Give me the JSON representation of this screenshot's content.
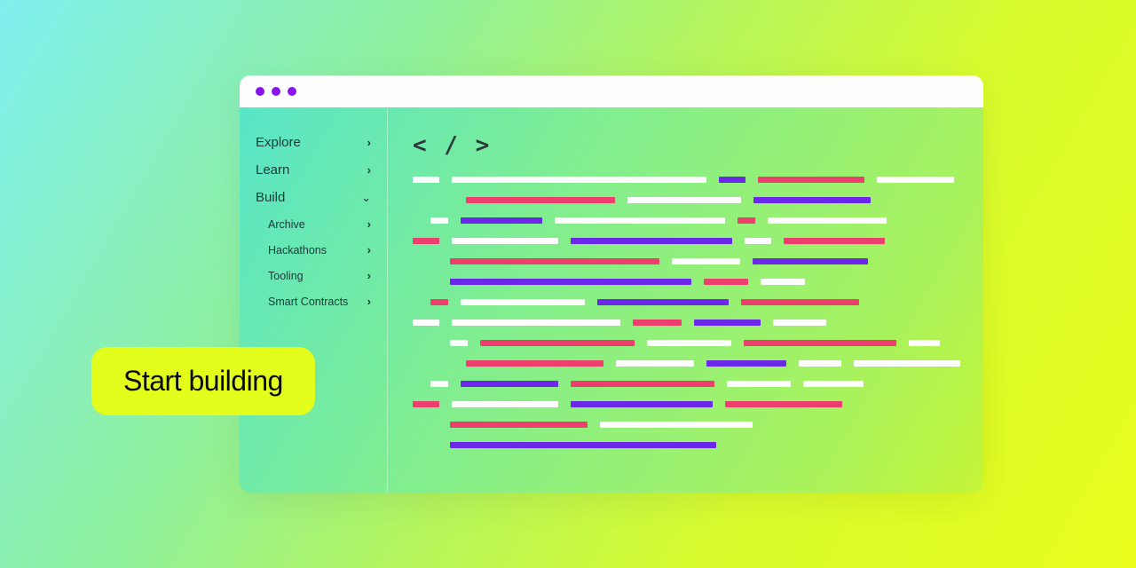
{
  "sidebar": {
    "items": [
      {
        "label": "Explore",
        "expanded": false
      },
      {
        "label": "Learn",
        "expanded": false
      },
      {
        "label": "Build",
        "expanded": true,
        "children": [
          {
            "label": "Archive"
          },
          {
            "label": "Hackathons"
          },
          {
            "label": "Tooling"
          },
          {
            "label": "Smart Contracts"
          }
        ]
      }
    ]
  },
  "code_icon": "< / >",
  "cta": {
    "label": "Start building"
  },
  "colors": {
    "accent_purple": "#8813EC",
    "accent_red": "#EC3F6E",
    "accent_violet": "#6B28E8",
    "cta_bg": "#E3FD1C"
  }
}
